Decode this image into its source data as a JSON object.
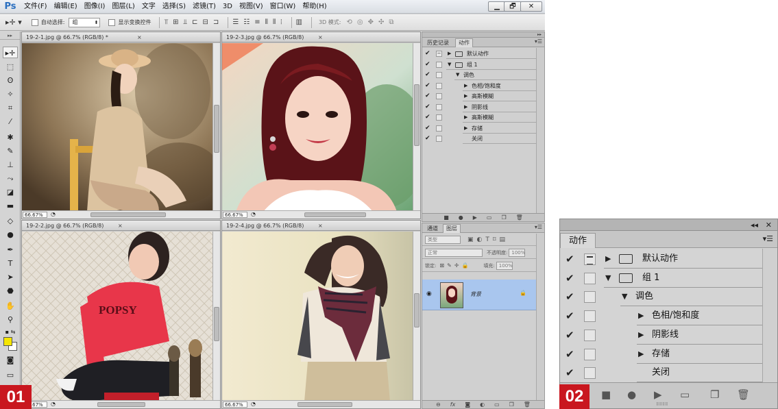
{
  "app": {
    "logo": "Ps"
  },
  "menu": [
    "文件(F)",
    "编辑(E)",
    "图像(I)",
    "图层(L)",
    "文字",
    "选择(S)",
    "滤镜(T)",
    "3D",
    "视图(V)",
    "窗口(W)",
    "帮助(H)"
  ],
  "window_controls": {
    "minimize": "▁",
    "restore": "🗗",
    "close": "✕"
  },
  "options_bar": {
    "auto_select_label": "自动选择:",
    "auto_select_value": "组",
    "show_transform_label": "显示变换控件",
    "mode_3d_label": "3D 模式:"
  },
  "documents": [
    {
      "title": "19-2-1.jpg @ 66.7% (RGB/8) *",
      "zoom": "66.67%"
    },
    {
      "title": "19-2-3.jpg @ 66.7% (RGB/8)",
      "zoom": "66.67%"
    },
    {
      "title": "19-2-2.jpg @ 66.7% (RGB/8)",
      "zoom": "66.67%"
    },
    {
      "title": "19-2-4.jpg @ 66.7% (RGB/8)",
      "zoom": "66.67%"
    }
  ],
  "doc_close": "×",
  "history_panel": {
    "tabs": [
      "历史记录",
      "动作"
    ],
    "actions": [
      {
        "label": "默认动作",
        "level": 0,
        "kind": "set",
        "expanded": false
      },
      {
        "label": "组 1",
        "level": 0,
        "kind": "set",
        "expanded": true
      },
      {
        "label": "调色",
        "level": 1,
        "kind": "action",
        "expanded": true
      },
      {
        "label": "色相/饱和度",
        "level": 2,
        "kind": "step",
        "expanded": false
      },
      {
        "label": "高斯模糊",
        "level": 2,
        "kind": "step",
        "expanded": false
      },
      {
        "label": "阴影线",
        "level": 2,
        "kind": "step",
        "expanded": false
      },
      {
        "label": "高斯模糊",
        "level": 2,
        "kind": "step",
        "expanded": false
      },
      {
        "label": "存储",
        "level": 2,
        "kind": "step",
        "expanded": false
      },
      {
        "label": "关闭",
        "level": 2,
        "kind": "plain",
        "expanded": false
      }
    ]
  },
  "layers_panel": {
    "tabs": [
      "通道",
      "图层"
    ],
    "kind_filter": "类型",
    "blend_mode": "正常",
    "opacity_label": "不透明度:",
    "opacity_value": "100%",
    "lock_label": "锁定:",
    "fill_label": "填充:",
    "fill_value": "100%",
    "layer_name": "背景"
  },
  "zoom_panel": {
    "collapse": "◂◂",
    "close": "✕",
    "tab": "动作",
    "menu": "▾☰",
    "actions": [
      {
        "label": "默认动作",
        "level": 0,
        "kind": "set",
        "expanded": false
      },
      {
        "label": "组 1",
        "level": 0,
        "kind": "set",
        "expanded": true
      },
      {
        "label": "调色",
        "level": 1,
        "kind": "action",
        "expanded": true
      },
      {
        "label": "色相/饱和度",
        "level": 2,
        "kind": "step",
        "expanded": false
      },
      {
        "label": "阴影线",
        "level": 2,
        "kind": "step",
        "expanded": false
      },
      {
        "label": "存储",
        "level": 2,
        "kind": "step",
        "expanded": false
      },
      {
        "label": "关闭",
        "level": 2,
        "kind": "plain",
        "expanded": false
      }
    ],
    "grip": "⠿⠿⠿⠿"
  },
  "icons": {
    "check": "✔",
    "tri_right": "▶",
    "tri_down": "▼",
    "stop": "■",
    "record": "●",
    "play": "▶",
    "folder": "▭",
    "new": "❐",
    "trash": "🗑"
  },
  "badges": [
    "01",
    "02"
  ],
  "colors": {
    "foreground": "#f5e600",
    "background": "#ffffff",
    "selected_layer": "#a9c6ee",
    "badge": "#c9171f"
  }
}
